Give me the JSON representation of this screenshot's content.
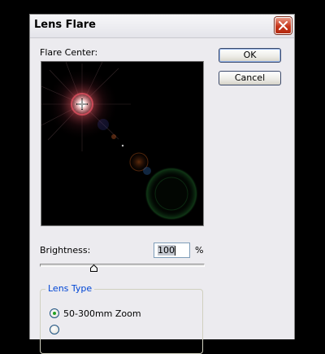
{
  "dialog": {
    "title": "Lens Flare",
    "close_icon": "close-x-icon"
  },
  "flare_center": {
    "label": "Flare Center:"
  },
  "buttons": {
    "ok": "OK",
    "cancel": "Cancel"
  },
  "brightness": {
    "label": "Brightness:",
    "value": "100",
    "unit": "%",
    "slider_level_fraction": 0.32
  },
  "lens_type": {
    "label": "Lens Type",
    "options": [
      {
        "label": "50-300mm Zoom",
        "selected": true
      },
      {
        "label": "",
        "selected": false
      }
    ]
  },
  "colors": {
    "group_label": "#0046d5",
    "close_button": "#c7361b",
    "radio_selected": "#21a121"
  }
}
